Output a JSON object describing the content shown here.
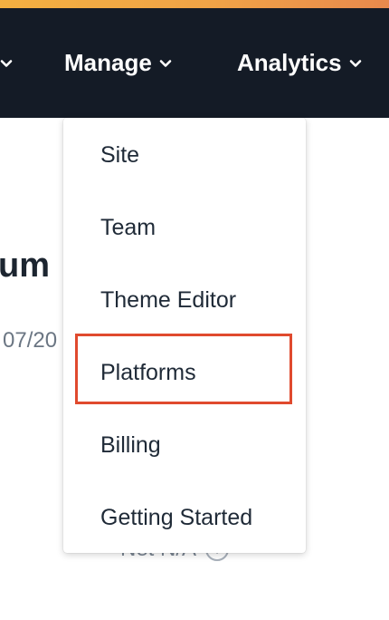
{
  "navbar": {
    "items": [
      {
        "label": "",
        "icon": "chevron-down-icon"
      },
      {
        "label": "Manage",
        "icon": "chevron-down-icon"
      },
      {
        "label": "Analytics",
        "icon": "chevron-down-icon"
      }
    ]
  },
  "background": {
    "heading_fragment": "um",
    "date_fragment": "07/20",
    "net_label": "Net N/A",
    "info_icon": "info-icon"
  },
  "manage_menu": {
    "items": [
      {
        "label": "Site"
      },
      {
        "label": "Team"
      },
      {
        "label": "Theme Editor"
      },
      {
        "label": "Platforms"
      },
      {
        "label": "Billing"
      },
      {
        "label": "Getting Started"
      }
    ],
    "highlighted_item": "Platforms"
  },
  "colors": {
    "navbar_bg": "#141b26",
    "accent_strip": "#f0a347",
    "highlight": "#e04a2e"
  }
}
